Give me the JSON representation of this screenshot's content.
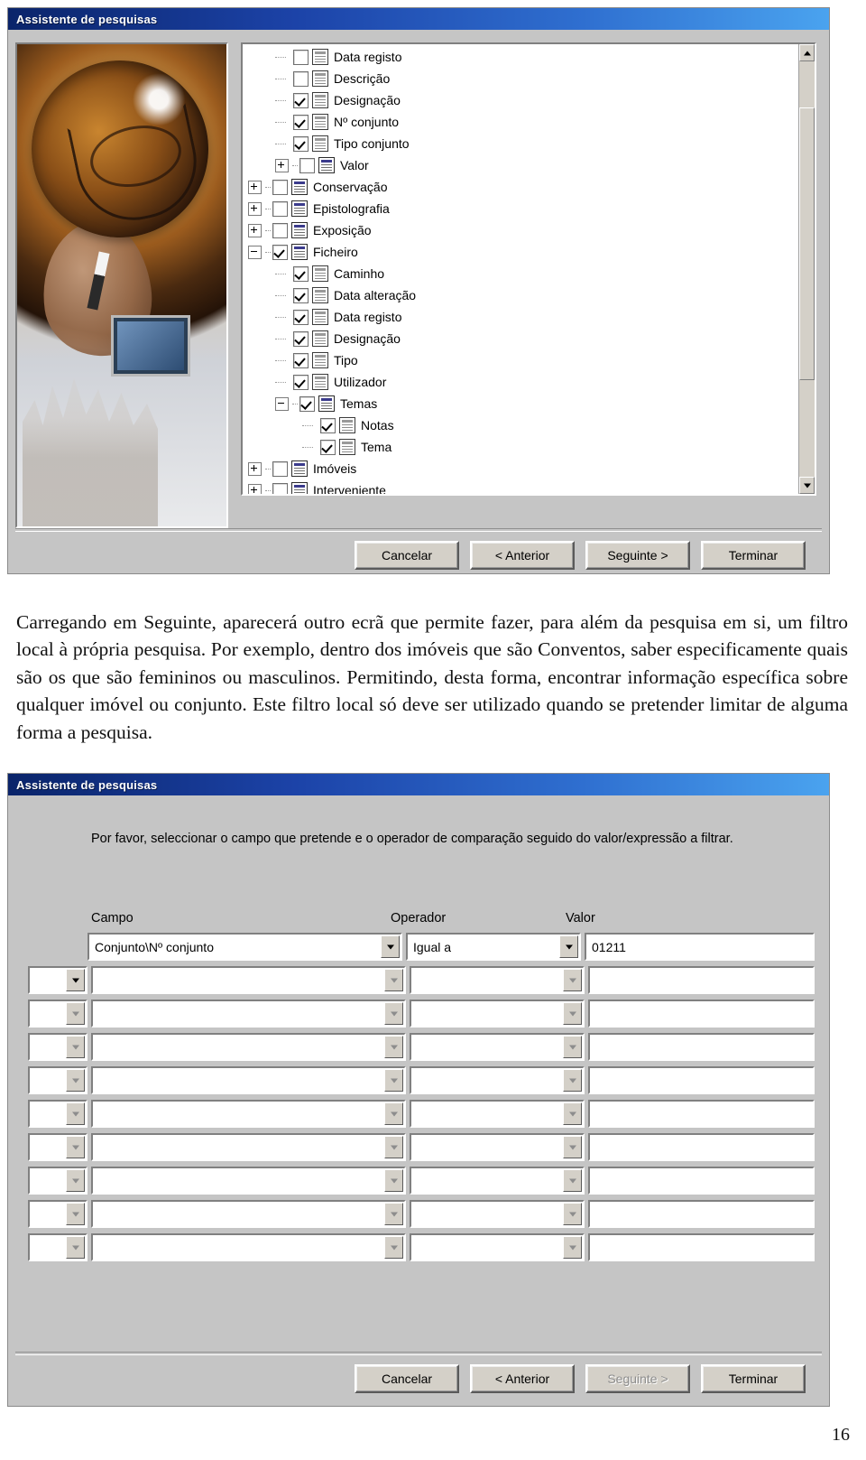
{
  "colors": {
    "title_gradient_start": "#0a246a",
    "title_gradient_end": "#4aa3ef",
    "dialog_face": "#c5c5c5",
    "button_face": "#d4d0c8"
  },
  "dialog1": {
    "title": "Assistente de pesquisas",
    "tree": {
      "scroll_position": "middle",
      "nodes": [
        {
          "label": "Data registo",
          "depth": 2,
          "expander": "none",
          "checked": false,
          "icon": "field-icon"
        },
        {
          "label": "Descrição",
          "depth": 2,
          "expander": "none",
          "checked": false,
          "icon": "field-icon"
        },
        {
          "label": "Designação",
          "depth": 2,
          "expander": "none",
          "checked": true,
          "icon": "field-icon"
        },
        {
          "label": "Nº conjunto",
          "depth": 2,
          "expander": "none",
          "checked": true,
          "icon": "field-icon"
        },
        {
          "label": "Tipo conjunto",
          "depth": 2,
          "expander": "none",
          "checked": true,
          "icon": "field-icon"
        },
        {
          "label": "Valor",
          "depth": 2,
          "expander": "plus",
          "checked": false,
          "icon": "table-icon"
        },
        {
          "label": "Conservação",
          "depth": 1,
          "expander": "plus",
          "checked": false,
          "icon": "table-icon"
        },
        {
          "label": "Epistolografia",
          "depth": 1,
          "expander": "plus",
          "checked": false,
          "icon": "table-icon"
        },
        {
          "label": "Exposição",
          "depth": 1,
          "expander": "plus",
          "checked": false,
          "icon": "table-icon"
        },
        {
          "label": "Ficheiro",
          "depth": 1,
          "expander": "minus",
          "checked": true,
          "icon": "table-icon"
        },
        {
          "label": "Caminho",
          "depth": 2,
          "expander": "none",
          "checked": true,
          "icon": "field-icon"
        },
        {
          "label": "Data alteração",
          "depth": 2,
          "expander": "none",
          "checked": true,
          "icon": "field-icon"
        },
        {
          "label": "Data registo",
          "depth": 2,
          "expander": "none",
          "checked": true,
          "icon": "field-icon"
        },
        {
          "label": "Designação",
          "depth": 2,
          "expander": "none",
          "checked": true,
          "icon": "field-icon"
        },
        {
          "label": "Tipo",
          "depth": 2,
          "expander": "none",
          "checked": true,
          "icon": "field-icon"
        },
        {
          "label": "Utilizador",
          "depth": 2,
          "expander": "none",
          "checked": true,
          "icon": "field-icon"
        },
        {
          "label": "Temas",
          "depth": 2,
          "expander": "minus",
          "checked": true,
          "icon": "table-icon"
        },
        {
          "label": "Notas",
          "depth": 3,
          "expander": "none",
          "checked": true,
          "icon": "field-icon"
        },
        {
          "label": "Tema",
          "depth": 3,
          "expander": "none",
          "checked": true,
          "icon": "field-icon"
        },
        {
          "label": "Imóveis",
          "depth": 1,
          "expander": "plus",
          "checked": false,
          "icon": "table-icon"
        },
        {
          "label": "Interveniente",
          "depth": 1,
          "expander": "plus",
          "checked": false,
          "icon": "table-icon"
        }
      ]
    },
    "buttons": [
      {
        "label": "Cancelar",
        "disabled": false
      },
      {
        "label": "< Anterior",
        "disabled": false
      },
      {
        "label": "Seguinte >",
        "disabled": false
      },
      {
        "label": "Terminar",
        "disabled": false
      }
    ]
  },
  "prose": {
    "paragraph": "Carregando em Seguinte, aparecerá outro ecrã que permite fazer, para além da pesquisa em si, um filtro local à própria pesquisa. Por exemplo, dentro dos imóveis que são Conventos, saber especificamente quais são os que são femininos ou masculinos. Permitindo, desta forma, encontrar informação específica sobre qualquer imóvel ou conjunto. Este filtro local só deve ser utilizado quando se pretender limitar de alguma forma a pesquisa."
  },
  "dialog2": {
    "title": "Assistente de pesquisas",
    "instruction": "Por favor, seleccionar o campo que pretende e o operador de comparação seguido do valor/expressão a filtrar.",
    "headers": {
      "campo": "Campo",
      "operador": "Operador",
      "valor": "Valor"
    },
    "rows": [
      {
        "logic": "",
        "campo": "Conjunto\\Nº conjunto",
        "operador": "Igual a",
        "valor": "01211",
        "first": true
      },
      {
        "logic": "",
        "campo": "",
        "operador": "",
        "valor": "",
        "first": false
      },
      {
        "logic": "",
        "campo": "",
        "operador": "",
        "valor": "",
        "first": false
      },
      {
        "logic": "",
        "campo": "",
        "operador": "",
        "valor": "",
        "first": false
      },
      {
        "logic": "",
        "campo": "",
        "operador": "",
        "valor": "",
        "first": false
      },
      {
        "logic": "",
        "campo": "",
        "operador": "",
        "valor": "",
        "first": false
      },
      {
        "logic": "",
        "campo": "",
        "operador": "",
        "valor": "",
        "first": false
      },
      {
        "logic": "",
        "campo": "",
        "operador": "",
        "valor": "",
        "first": false
      },
      {
        "logic": "",
        "campo": "",
        "operador": "",
        "valor": "",
        "first": false
      },
      {
        "logic": "",
        "campo": "",
        "operador": "",
        "valor": "",
        "first": false
      }
    ],
    "buttons": [
      {
        "label": "Cancelar",
        "disabled": false
      },
      {
        "label": "< Anterior",
        "disabled": false
      },
      {
        "label": "Seguinte >",
        "disabled": true
      },
      {
        "label": "Terminar",
        "disabled": false
      }
    ]
  },
  "page_number": "16"
}
